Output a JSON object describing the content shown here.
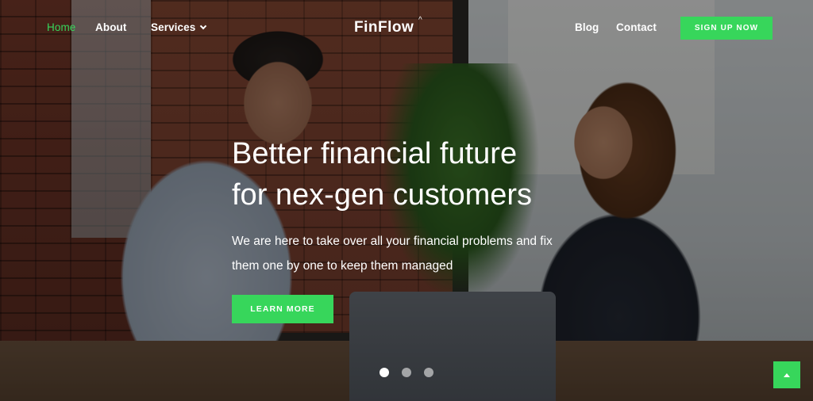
{
  "brand": {
    "name": "FinFlow",
    "accent_color": "#37d65b"
  },
  "nav": {
    "left_links": [
      {
        "label": "Home",
        "active": true
      },
      {
        "label": "About",
        "active": false
      },
      {
        "label": "Services",
        "active": false,
        "has_dropdown": true
      }
    ],
    "right_links": [
      {
        "label": "Blog"
      },
      {
        "label": "Contact"
      }
    ],
    "cta_label": "SIGN UP NOW"
  },
  "hero": {
    "title_line1": "Better financial future",
    "title_line2": "for nex-gen customers",
    "subtitle": "We are here to take over all your financial problems and fix them one by one to keep them managed",
    "cta_label": "LEARN MORE",
    "background_image": "two-colleagues-high-five-office-photo"
  },
  "slider": {
    "total_slides": 3,
    "active_index": 0
  },
  "back_to_top": {
    "icon": "arrow-up-icon"
  }
}
